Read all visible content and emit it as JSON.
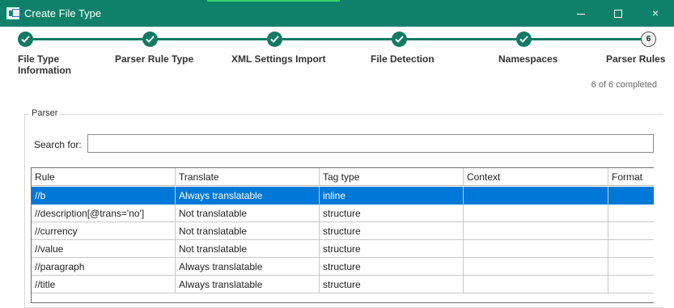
{
  "window": {
    "title": "Create File Type",
    "controls": {
      "minimize": "minimize-icon",
      "maximize": "maximize-icon",
      "close": "×"
    }
  },
  "wizard": {
    "steps": [
      {
        "label": "File Type\nInformation",
        "state": "done"
      },
      {
        "label": "Parser Rule Type",
        "state": "done"
      },
      {
        "label": "XML Settings Import",
        "state": "done"
      },
      {
        "label": "File Detection",
        "state": "done"
      },
      {
        "label": "Namespaces",
        "state": "done"
      },
      {
        "label": "Parser Rules",
        "state": "current",
        "number": "6"
      }
    ],
    "progress": "6 of 6 completed"
  },
  "parser": {
    "group_label": "Parser",
    "search_label": "Search for:",
    "search_value": "",
    "columns": [
      "Rule",
      "Translate",
      "Tag type",
      "Context",
      "Format"
    ],
    "rows": [
      {
        "rule": "//b",
        "translate": "Always translatable",
        "tag_type": "inline",
        "context": "",
        "format": "",
        "selected": true
      },
      {
        "rule": "//description[@trans='no']",
        "translate": "Not translatable",
        "tag_type": "structure",
        "context": "",
        "format": ""
      },
      {
        "rule": "//currency",
        "translate": "Not translatable",
        "tag_type": "structure",
        "context": "",
        "format": ""
      },
      {
        "rule": "//value",
        "translate": "Not translatable",
        "tag_type": "structure",
        "context": "",
        "format": ""
      },
      {
        "rule": "//paragraph",
        "translate": "Always translatable",
        "tag_type": "structure",
        "context": "",
        "format": ""
      },
      {
        "rule": "//title",
        "translate": "Always translatable",
        "tag_type": "structure",
        "context": "",
        "format": ""
      }
    ]
  },
  "colors": {
    "titlebar": "#0f8069",
    "step_done": "#137a63",
    "selection": "#0078d7"
  }
}
